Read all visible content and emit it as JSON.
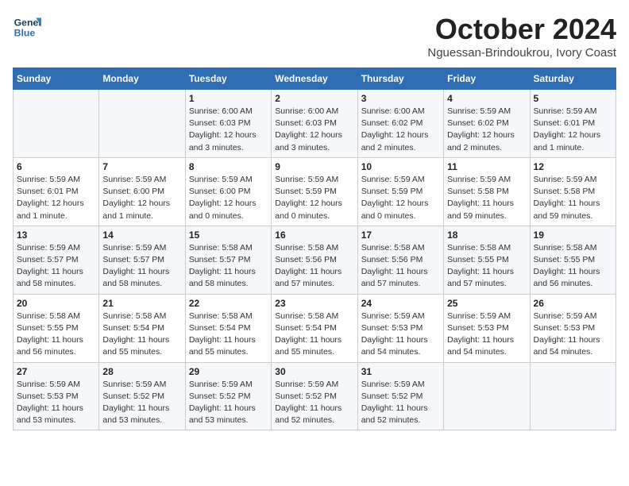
{
  "header": {
    "logo_line1": "General",
    "logo_line2": "Blue",
    "title": "October 2024",
    "subtitle": "Nguessan-Brindoukrou, Ivory Coast"
  },
  "days_of_week": [
    "Sunday",
    "Monday",
    "Tuesday",
    "Wednesday",
    "Thursday",
    "Friday",
    "Saturday"
  ],
  "weeks": [
    [
      {
        "day": "",
        "info": ""
      },
      {
        "day": "",
        "info": ""
      },
      {
        "day": "1",
        "info": "Sunrise: 6:00 AM\nSunset: 6:03 PM\nDaylight: 12 hours and 3 minutes."
      },
      {
        "day": "2",
        "info": "Sunrise: 6:00 AM\nSunset: 6:03 PM\nDaylight: 12 hours and 3 minutes."
      },
      {
        "day": "3",
        "info": "Sunrise: 6:00 AM\nSunset: 6:02 PM\nDaylight: 12 hours and 2 minutes."
      },
      {
        "day": "4",
        "info": "Sunrise: 5:59 AM\nSunset: 6:02 PM\nDaylight: 12 hours and 2 minutes."
      },
      {
        "day": "5",
        "info": "Sunrise: 5:59 AM\nSunset: 6:01 PM\nDaylight: 12 hours and 1 minute."
      }
    ],
    [
      {
        "day": "6",
        "info": "Sunrise: 5:59 AM\nSunset: 6:01 PM\nDaylight: 12 hours and 1 minute."
      },
      {
        "day": "7",
        "info": "Sunrise: 5:59 AM\nSunset: 6:00 PM\nDaylight: 12 hours and 1 minute."
      },
      {
        "day": "8",
        "info": "Sunrise: 5:59 AM\nSunset: 6:00 PM\nDaylight: 12 hours and 0 minutes."
      },
      {
        "day": "9",
        "info": "Sunrise: 5:59 AM\nSunset: 5:59 PM\nDaylight: 12 hours and 0 minutes."
      },
      {
        "day": "10",
        "info": "Sunrise: 5:59 AM\nSunset: 5:59 PM\nDaylight: 12 hours and 0 minutes."
      },
      {
        "day": "11",
        "info": "Sunrise: 5:59 AM\nSunset: 5:58 PM\nDaylight: 11 hours and 59 minutes."
      },
      {
        "day": "12",
        "info": "Sunrise: 5:59 AM\nSunset: 5:58 PM\nDaylight: 11 hours and 59 minutes."
      }
    ],
    [
      {
        "day": "13",
        "info": "Sunrise: 5:59 AM\nSunset: 5:57 PM\nDaylight: 11 hours and 58 minutes."
      },
      {
        "day": "14",
        "info": "Sunrise: 5:59 AM\nSunset: 5:57 PM\nDaylight: 11 hours and 58 minutes."
      },
      {
        "day": "15",
        "info": "Sunrise: 5:58 AM\nSunset: 5:57 PM\nDaylight: 11 hours and 58 minutes."
      },
      {
        "day": "16",
        "info": "Sunrise: 5:58 AM\nSunset: 5:56 PM\nDaylight: 11 hours and 57 minutes."
      },
      {
        "day": "17",
        "info": "Sunrise: 5:58 AM\nSunset: 5:56 PM\nDaylight: 11 hours and 57 minutes."
      },
      {
        "day": "18",
        "info": "Sunrise: 5:58 AM\nSunset: 5:55 PM\nDaylight: 11 hours and 57 minutes."
      },
      {
        "day": "19",
        "info": "Sunrise: 5:58 AM\nSunset: 5:55 PM\nDaylight: 11 hours and 56 minutes."
      }
    ],
    [
      {
        "day": "20",
        "info": "Sunrise: 5:58 AM\nSunset: 5:55 PM\nDaylight: 11 hours and 56 minutes."
      },
      {
        "day": "21",
        "info": "Sunrise: 5:58 AM\nSunset: 5:54 PM\nDaylight: 11 hours and 55 minutes."
      },
      {
        "day": "22",
        "info": "Sunrise: 5:58 AM\nSunset: 5:54 PM\nDaylight: 11 hours and 55 minutes."
      },
      {
        "day": "23",
        "info": "Sunrise: 5:58 AM\nSunset: 5:54 PM\nDaylight: 11 hours and 55 minutes."
      },
      {
        "day": "24",
        "info": "Sunrise: 5:59 AM\nSunset: 5:53 PM\nDaylight: 11 hours and 54 minutes."
      },
      {
        "day": "25",
        "info": "Sunrise: 5:59 AM\nSunset: 5:53 PM\nDaylight: 11 hours and 54 minutes."
      },
      {
        "day": "26",
        "info": "Sunrise: 5:59 AM\nSunset: 5:53 PM\nDaylight: 11 hours and 54 minutes."
      }
    ],
    [
      {
        "day": "27",
        "info": "Sunrise: 5:59 AM\nSunset: 5:53 PM\nDaylight: 11 hours and 53 minutes."
      },
      {
        "day": "28",
        "info": "Sunrise: 5:59 AM\nSunset: 5:52 PM\nDaylight: 11 hours and 53 minutes."
      },
      {
        "day": "29",
        "info": "Sunrise: 5:59 AM\nSunset: 5:52 PM\nDaylight: 11 hours and 53 minutes."
      },
      {
        "day": "30",
        "info": "Sunrise: 5:59 AM\nSunset: 5:52 PM\nDaylight: 11 hours and 52 minutes."
      },
      {
        "day": "31",
        "info": "Sunrise: 5:59 AM\nSunset: 5:52 PM\nDaylight: 11 hours and 52 minutes."
      },
      {
        "day": "",
        "info": ""
      },
      {
        "day": "",
        "info": ""
      }
    ]
  ]
}
